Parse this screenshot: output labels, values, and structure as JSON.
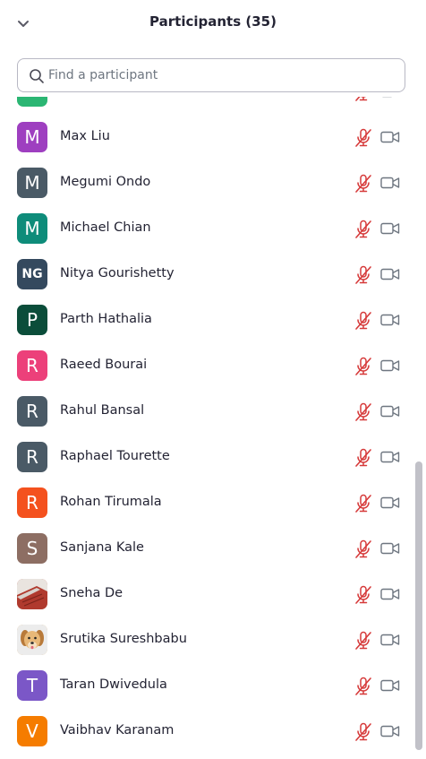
{
  "header": {
    "title": "Participants (35)"
  },
  "search": {
    "placeholder": "Find a participant",
    "value": ""
  },
  "colors": {
    "muted_mic": "#d63a3a",
    "camera_icon": "#6e7680"
  },
  "participants": [
    {
      "name": "",
      "initials": "",
      "color": "#2bb673",
      "avatar_type": "partial"
    },
    {
      "name": "Max Liu",
      "initials": "M",
      "color": "#9e3fc0"
    },
    {
      "name": "Megumi Ondo",
      "initials": "M",
      "color": "#4a5a66"
    },
    {
      "name": "Michael Chian",
      "initials": "M",
      "color": "#0e8c7a"
    },
    {
      "name": "Nitya Gourishetty",
      "initials": "NG",
      "color": "#34495e"
    },
    {
      "name": "Parth Hathalia",
      "initials": "P",
      "color": "#0b4d3a"
    },
    {
      "name": "Raeed Bourai",
      "initials": "R",
      "color": "#ec407a"
    },
    {
      "name": "Rahul Bansal",
      "initials": "R",
      "color": "#4a5a66"
    },
    {
      "name": "Raphael Tourette",
      "initials": "R",
      "color": "#4a5a66"
    },
    {
      "name": "Rohan Tirumala",
      "initials": "R",
      "color": "#f4511e"
    },
    {
      "name": "Sanjana Kale",
      "initials": "S",
      "color": "#8d6e63"
    },
    {
      "name": "Sneha De",
      "initials": "",
      "color": "#b84a3a",
      "avatar_type": "photo-room"
    },
    {
      "name": "Srutika Sureshbabu",
      "initials": "",
      "color": "#d9a45a",
      "avatar_type": "photo-dog"
    },
    {
      "name": "Taran Dwivedula",
      "initials": "T",
      "color": "#7b57c7"
    },
    {
      "name": "Vaibhav Karanam",
      "initials": "V",
      "color": "#f57c00"
    }
  ]
}
